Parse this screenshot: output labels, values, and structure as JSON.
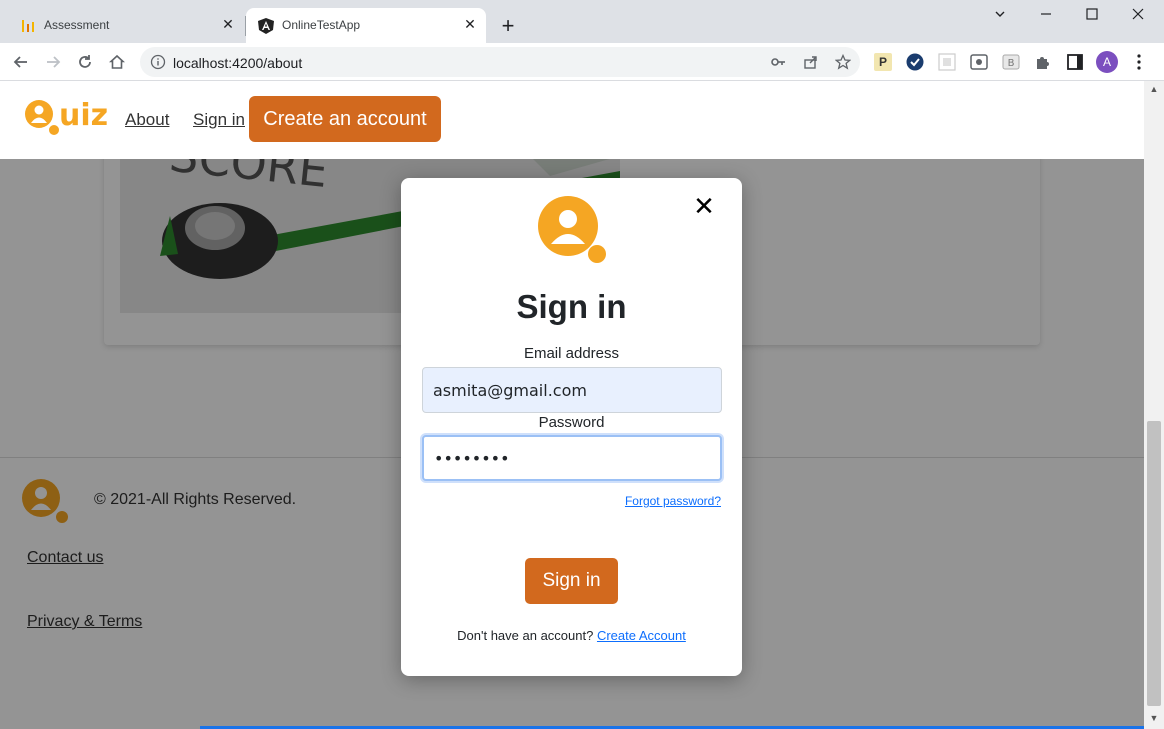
{
  "browser": {
    "tabs": [
      {
        "label": "Assessment",
        "active": false
      },
      {
        "label": "OnlineTestApp",
        "active": true
      }
    ],
    "new_tab_symbol": "+",
    "close_symbol": "✕",
    "window": {
      "minimize": "—",
      "maximize": "☐",
      "close": "✕",
      "tab_search": "⌄"
    },
    "url": "localhost:4200/about",
    "profile_initial": "A",
    "icons": [
      "back-icon",
      "forward-icon",
      "reload-icon",
      "home-icon",
      "info-icon",
      "key-icon",
      "share-icon",
      "star-icon",
      "extensions-icon",
      "sidebar-icon",
      "menu-icon"
    ]
  },
  "header": {
    "logo_text": "Quiz",
    "nav": [
      {
        "label": "About "
      },
      {
        "label": "Sign in"
      }
    ],
    "cta_label": "Create an account"
  },
  "content": {
    "image_text": "SCORE"
  },
  "footer": {
    "copyright": "© 2021-All Rights Reserved.",
    "links": [
      {
        "label": "Contact us"
      },
      {
        "label": "Privacy & Terms"
      }
    ]
  },
  "modal": {
    "close_symbol": "✕",
    "title": "Sign in",
    "email_label": "Email address",
    "email_value": "asmita@gmail.com",
    "password_label": "Password",
    "password_value": "••••••••",
    "forgot_label": "Forgot password?",
    "submit_label": "Sign in",
    "no_account_text": "Don't have an account?",
    "create_account_label": "Create Account"
  },
  "colors": {
    "brand_orange": "#d2691e",
    "logo_yellow": "#f5a623",
    "link_blue": "#0d6efd"
  }
}
